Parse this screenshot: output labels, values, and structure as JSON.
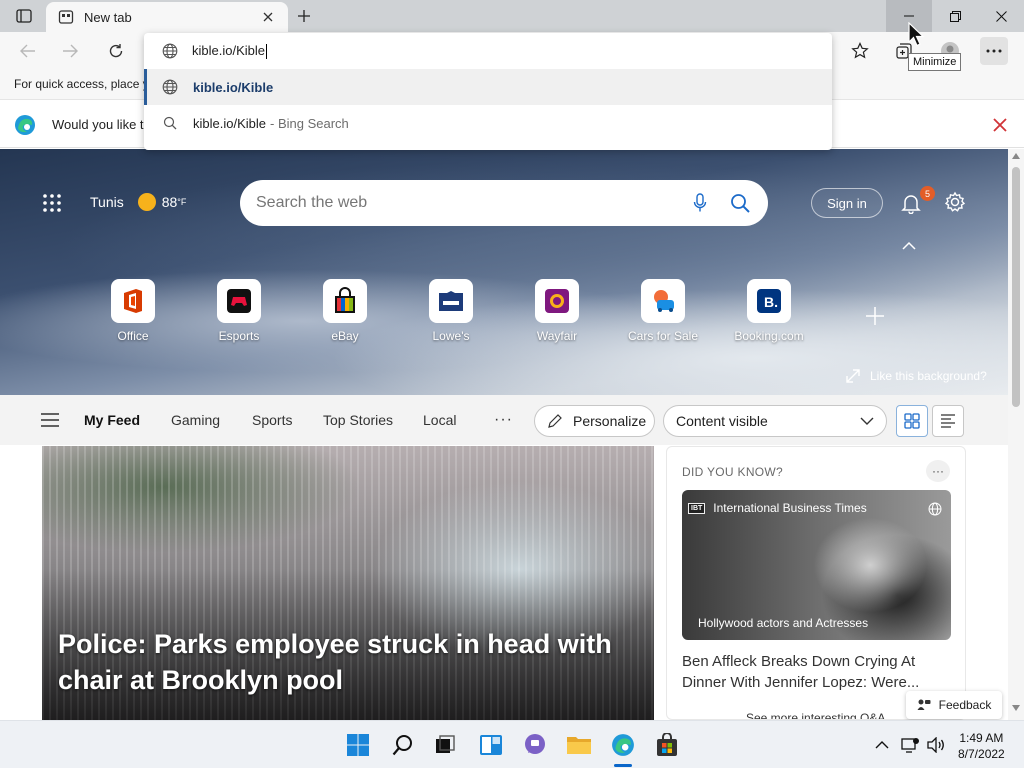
{
  "browser": {
    "tab_title": "New tab",
    "tooltip": "Minimize",
    "favorites_hint": "For quick access, place y",
    "info_message": "Would you like t"
  },
  "omnibox": {
    "typed": "kible.io/Kible",
    "suggestions": [
      {
        "text": "kible.io/Kible",
        "suffix": "",
        "icon": "globe-icon"
      },
      {
        "text": "kible.io/Kible",
        "suffix": "- Bing Search",
        "icon": "search-icon"
      }
    ]
  },
  "hero": {
    "location": "Tunis",
    "temperature": "88",
    "temp_unit": "°F",
    "search_placeholder": "Search the web",
    "signin_label": "Sign in",
    "notifications_count": "5",
    "like_background": "Like this background?",
    "quick_links": [
      {
        "label": "Office",
        "icon": "office-icon"
      },
      {
        "label": "Esports",
        "icon": "gamepad-icon"
      },
      {
        "label": "eBay",
        "icon": "shopping-bag-icon"
      },
      {
        "label": "Lowe's",
        "icon": "lowes-icon"
      },
      {
        "label": "Wayfair",
        "icon": "wayfair-icon"
      },
      {
        "label": "Cars for Sale",
        "icon": "car-icon"
      },
      {
        "label": "Booking.com",
        "icon": "booking-icon"
      }
    ]
  },
  "feed_nav": {
    "items": [
      "My Feed",
      "Gaming",
      "Sports",
      "Top Stories",
      "Local"
    ],
    "more": "···",
    "personalize_label": "Personalize",
    "content_visibility": "Content visible"
  },
  "main_story": {
    "headline": "Police: Parks employee struck in head with chair at Brooklyn pool"
  },
  "side_card": {
    "kicker": "DID YOU KNOW?",
    "source_badge": "IBT",
    "source": "International Business Times",
    "image_caption": "Hollywood actors and Actresses",
    "title": "Ben Affleck Breaks Down Crying At Dinner With Jennifer Lopez: Were...",
    "see_more": "See more interesting Q&A"
  },
  "feedback_label": "Feedback",
  "taskbar": {
    "time": "1:49 AM",
    "date": "8/7/2022"
  },
  "colors": {
    "accent": "#0a66c9",
    "notification_badge": "#e35d28",
    "suggestion_highlight": "#2a5d9a"
  }
}
